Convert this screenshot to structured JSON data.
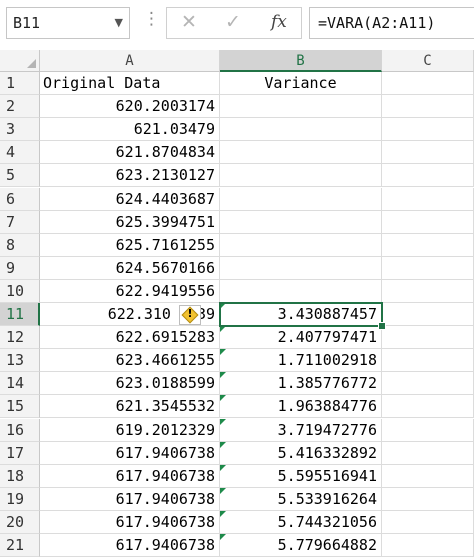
{
  "formula_bar": {
    "name_box": "B11",
    "more_glyph": "⋮",
    "cancel_glyph": "✕",
    "enter_glyph": "✓",
    "fx_label": "fx",
    "formula": "=VARA(A2:A11)"
  },
  "columns": [
    "A",
    "B",
    "C"
  ],
  "selected_cell": "B11",
  "rows": [
    {
      "n": "1",
      "a": "Original Data",
      "b": "Variance",
      "flag_b": false
    },
    {
      "n": "2",
      "a": "620.2003174",
      "b": "",
      "flag_b": false
    },
    {
      "n": "3",
      "a": "621.03479",
      "b": "",
      "flag_b": false
    },
    {
      "n": "4",
      "a": "621.8704834",
      "b": "",
      "flag_b": false
    },
    {
      "n": "5",
      "a": "623.2130127",
      "b": "",
      "flag_b": false
    },
    {
      "n": "6",
      "a": "624.4403687",
      "b": "",
      "flag_b": false
    },
    {
      "n": "7",
      "a": "625.3994751",
      "b": "",
      "flag_b": false
    },
    {
      "n": "8",
      "a": "625.7161255",
      "b": "",
      "flag_b": false
    },
    {
      "n": "9",
      "a": "624.5670166",
      "b": "",
      "flag_b": false
    },
    {
      "n": "10",
      "a": "622.9419556",
      "b": "",
      "flag_b": false
    },
    {
      "n": "11",
      "a": "622.310",
      "a_tail": "39",
      "b": "3.430887457",
      "flag_b": true
    },
    {
      "n": "12",
      "a": "622.6915283",
      "b": "2.407797471",
      "flag_b": true
    },
    {
      "n": "13",
      "a": "623.4661255",
      "b": "1.711002918",
      "flag_b": true
    },
    {
      "n": "14",
      "a": "623.0188599",
      "b": "1.385776772",
      "flag_b": true
    },
    {
      "n": "15",
      "a": "621.3545532",
      "b": "1.963884776",
      "flag_b": true
    },
    {
      "n": "16",
      "a": "619.2012329",
      "b": "3.719472776",
      "flag_b": true
    },
    {
      "n": "17",
      "a": "617.9406738",
      "b": "5.416332892",
      "flag_b": true
    },
    {
      "n": "18",
      "a": "617.9406738",
      "b": "5.595516941",
      "flag_b": true
    },
    {
      "n": "19",
      "a": "617.9406738",
      "b": "5.533916264",
      "flag_b": true
    },
    {
      "n": "20",
      "a": "617.9406738",
      "b": "5.744321056",
      "flag_b": true
    },
    {
      "n": "21",
      "a": "617.9406738",
      "b": "5.779664882",
      "flag_b": true
    }
  ],
  "warning_icon": "warning-diamond-icon",
  "colors": {
    "accent_green": "#217346",
    "flag_green": "#1e8a4a",
    "header_bg": "#f3f3f3",
    "selected_header_bg": "#d3d3d3"
  }
}
